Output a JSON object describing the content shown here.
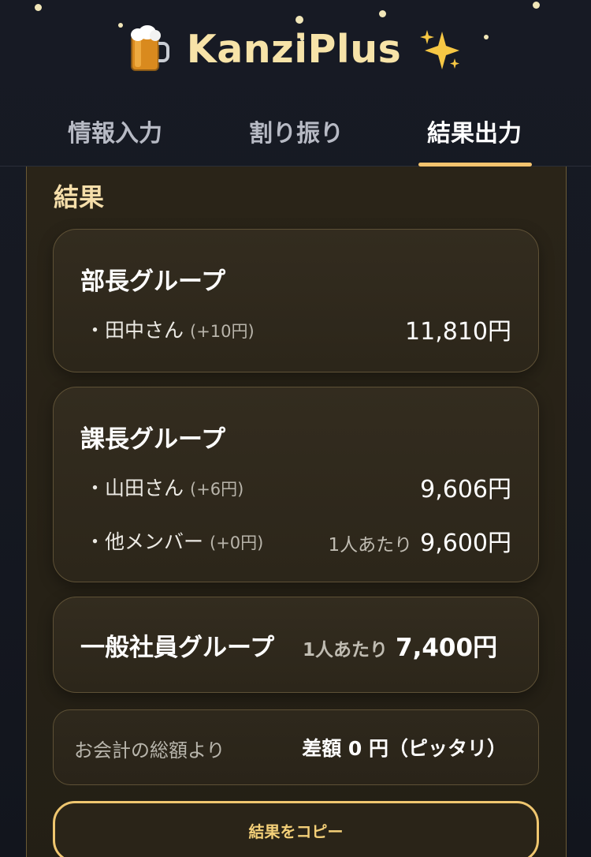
{
  "app": {
    "title": "KanziPlus"
  },
  "tabs": [
    {
      "label": "情報入力"
    },
    {
      "label": "割り振り"
    },
    {
      "label": "結果出力"
    }
  ],
  "active_tab": "結果出力",
  "results": {
    "section_title": "結果",
    "groups": [
      {
        "name": "部長グループ",
        "members": [
          {
            "name": "・田中さん",
            "diff": "(+10円)",
            "amount": "11,810円"
          }
        ]
      },
      {
        "name": "課長グループ",
        "members": [
          {
            "name": "・山田さん",
            "diff": "(+6円)",
            "amount": "9,606円"
          },
          {
            "name": "・他メンバー",
            "diff": "(+0円)",
            "per_label": "1人あたり",
            "amount": "9,600円"
          }
        ]
      },
      {
        "name": "一般社員グループ",
        "per_label": "1人あたり",
        "amount": "7,400円"
      }
    ],
    "summary": {
      "label": "お会計の総額より",
      "value": "差額 0 円（ピッタリ）"
    },
    "copy_button": "結果をコピー"
  },
  "colors": {
    "accent": "#f4c46e",
    "background": "#141720",
    "card": "#2c261a"
  }
}
